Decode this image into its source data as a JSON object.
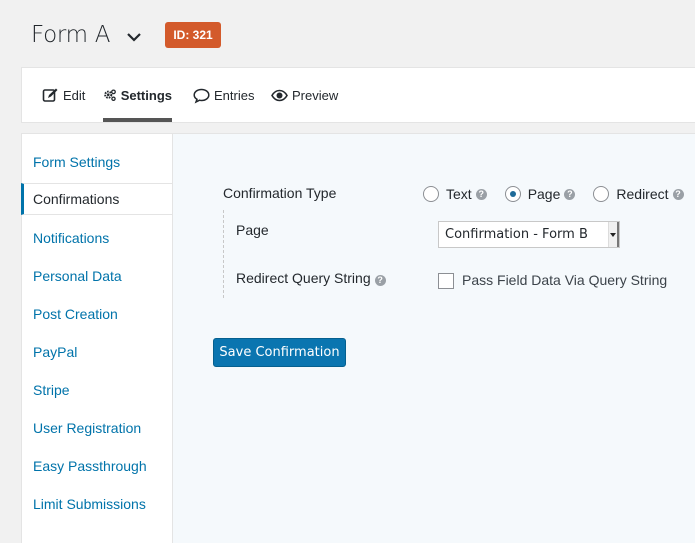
{
  "header": {
    "form_title": "Form A",
    "id_badge": "ID: 321"
  },
  "toolbar": {
    "items": [
      {
        "label": "Edit",
        "icon": "edit-icon"
      },
      {
        "label": "Settings",
        "icon": "gear-icon",
        "active": true
      },
      {
        "label": "Entries",
        "icon": "comment-icon"
      },
      {
        "label": "Preview",
        "icon": "eye-icon"
      }
    ]
  },
  "sidebar": {
    "items": [
      {
        "label": "Form Settings"
      },
      {
        "label": "Confirmations",
        "active": true
      },
      {
        "label": "Notifications"
      },
      {
        "label": "Personal Data"
      },
      {
        "label": "Post Creation"
      },
      {
        "label": "PayPal"
      },
      {
        "label": "Stripe"
      },
      {
        "label": "User Registration"
      },
      {
        "label": "Easy Passthrough"
      },
      {
        "label": "Limit Submissions"
      }
    ]
  },
  "confirmation": {
    "type_label": "Confirmation Type",
    "options": [
      {
        "label": "Text",
        "checked": false
      },
      {
        "label": "Page",
        "checked": true
      },
      {
        "label": "Redirect",
        "checked": false
      }
    ],
    "page_label": "Page",
    "page_select_value": "Confirmation - Form B",
    "redirect_query_label": "Redirect Query String",
    "pass_field_label": "Pass Field Data Via Query String",
    "save_label": "Save Confirmation"
  },
  "colors": {
    "badge": "#d35a2b",
    "link": "#0073aa",
    "primary_button": "#0a75b0"
  }
}
